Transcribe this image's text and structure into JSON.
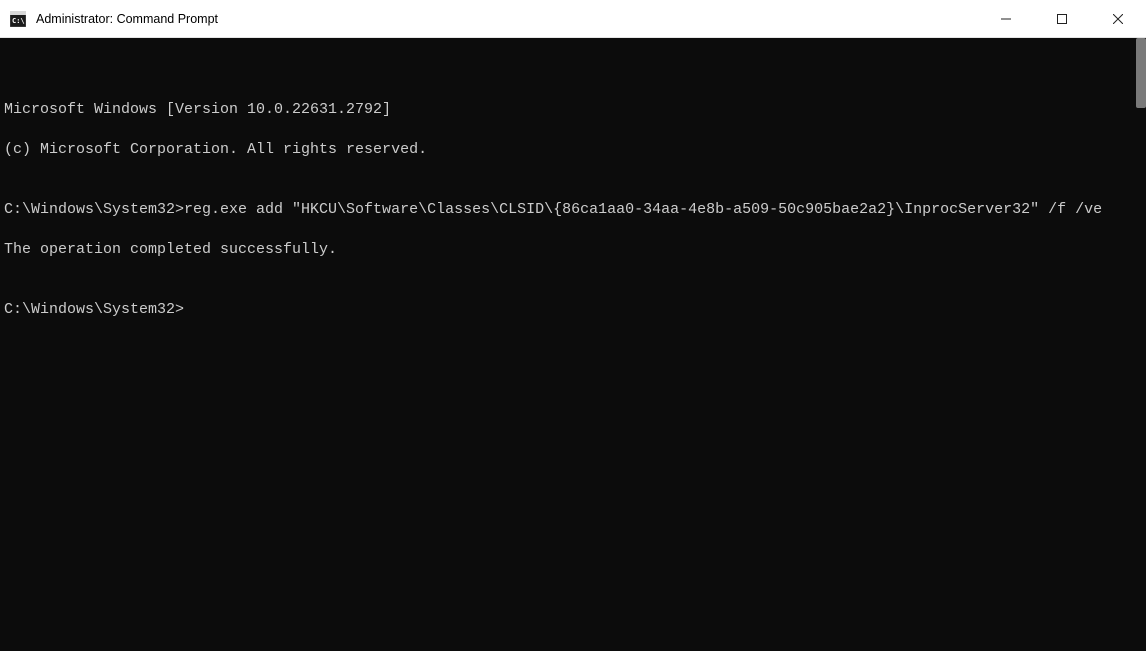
{
  "window": {
    "title": "Administrator: Command Prompt"
  },
  "terminal": {
    "lines": {
      "version": "Microsoft Windows [Version 10.0.22631.2792]",
      "copyright": "(c) Microsoft Corporation. All rights reserved.",
      "blank1": "",
      "cmd1": "C:\\Windows\\System32>reg.exe add \"HKCU\\Software\\Classes\\CLSID\\{86ca1aa0-34aa-4e8b-a509-50c905bae2a2}\\InprocServer32\" /f /ve",
      "result": "The operation completed successfully.",
      "blank2": "",
      "prompt": "C:\\Windows\\System32>"
    }
  }
}
